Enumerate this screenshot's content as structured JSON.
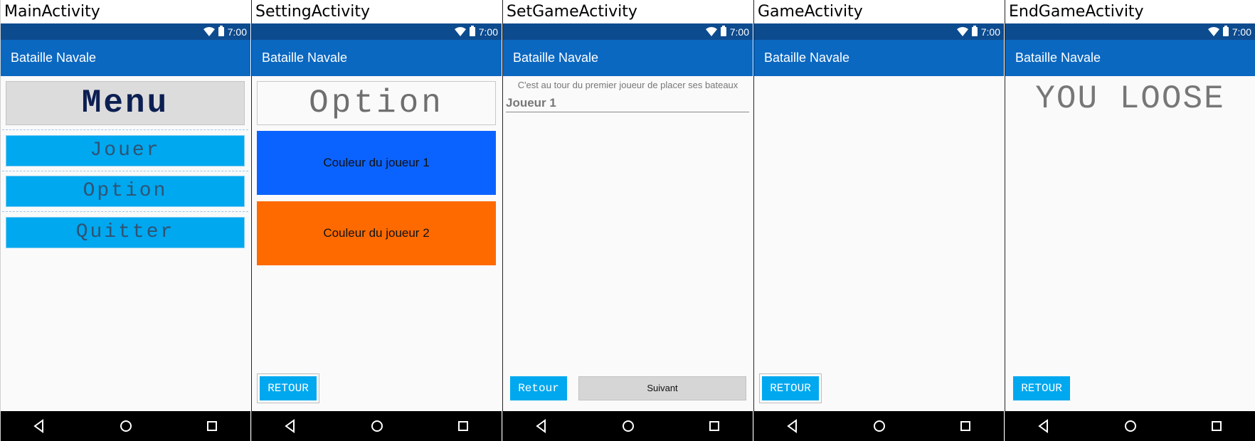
{
  "status": {
    "time": "7:00"
  },
  "app_title": "Bataille Navale",
  "screens": {
    "main": {
      "caption": "MainActivity",
      "menu_title": "Menu",
      "buttons": [
        "Jouer",
        "Option",
        "Quitter"
      ]
    },
    "setting": {
      "caption": "SettingActivity",
      "title": "Option",
      "player1_label": "Couleur du joueur 1",
      "player2_label": "Couleur du joueur 2",
      "player1_color": "#0b63ff",
      "player2_color": "#ff6a00",
      "back_label": "RETOUR"
    },
    "setgame": {
      "caption": "SetGameActivity",
      "instruction": "C'est au tour du premier joueur de placer ses bateaux",
      "player_name": "Joueur 1",
      "back_label": "Retour",
      "next_label": "Suivant"
    },
    "game": {
      "caption": "GameActivity",
      "back_label": "RETOUR"
    },
    "endgame": {
      "caption": "EndGameActivity",
      "result": "YOU LOOSE",
      "back_label": "RETOUR"
    }
  },
  "colors": {
    "status_bar": "#0d4b8f",
    "app_bar": "#0b68c1",
    "button_accent": "#00a8ef",
    "background": "#fafafa"
  },
  "icons": {
    "nav": [
      "back-triangle-icon",
      "home-circle-icon",
      "recents-square-icon"
    ],
    "status": [
      "wifi-icon",
      "battery-icon"
    ]
  }
}
